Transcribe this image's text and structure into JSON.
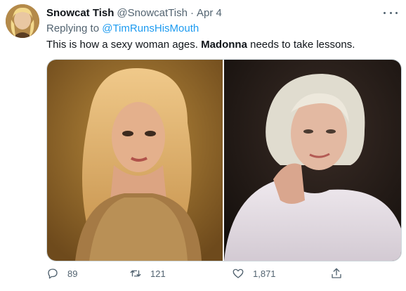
{
  "tweet": {
    "author_name": "Snowcat Tish",
    "author_handle": "@SnowcatTish",
    "separator": "·",
    "date": "Apr 4",
    "reply_prefix": "Replying to",
    "reply_to": "@TimRunsHisMouth",
    "text_before": "This is how a sexy woman ages. ",
    "text_bold": "Madonna",
    "text_after": " needs to take lessons."
  },
  "actions": {
    "replies": "89",
    "retweets": "121",
    "likes": "1,871"
  },
  "colors": {
    "link": "#1d9bf0",
    "secondary_text": "#536471",
    "primary_text": "#0f1419"
  }
}
